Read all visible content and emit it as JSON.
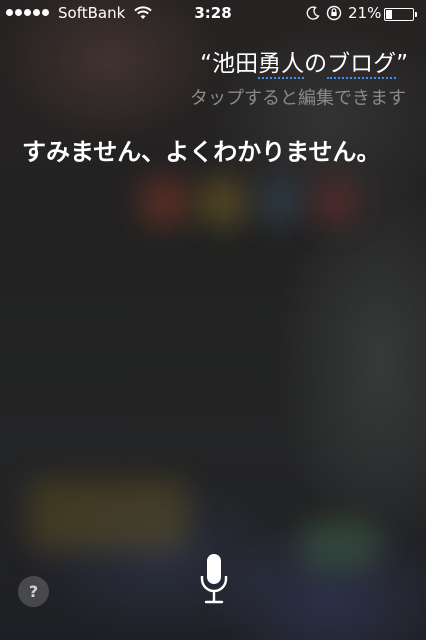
{
  "status_bar": {
    "carrier": "SoftBank",
    "time": "3:28",
    "battery_percent": "21%",
    "battery_level": 0.21,
    "icons": [
      "signal-dots-icon",
      "wifi-icon",
      "moon-icon",
      "rotation-lock-icon",
      "battery-icon"
    ]
  },
  "siri": {
    "query_open_quote": "“",
    "query_part1": "池田",
    "query_part2": "勇人",
    "query_part3": "の",
    "query_part4": "ブログ",
    "query_close_quote": "”",
    "tap_to_edit_hint": "タップすると編集できます",
    "response": "すみません、よくわかりません。"
  },
  "controls": {
    "help_label": "?",
    "mic_icon": "microphone-icon"
  },
  "colors": {
    "dictation_underline": "#3f8cff",
    "hint_text": "#8a8a8a"
  }
}
